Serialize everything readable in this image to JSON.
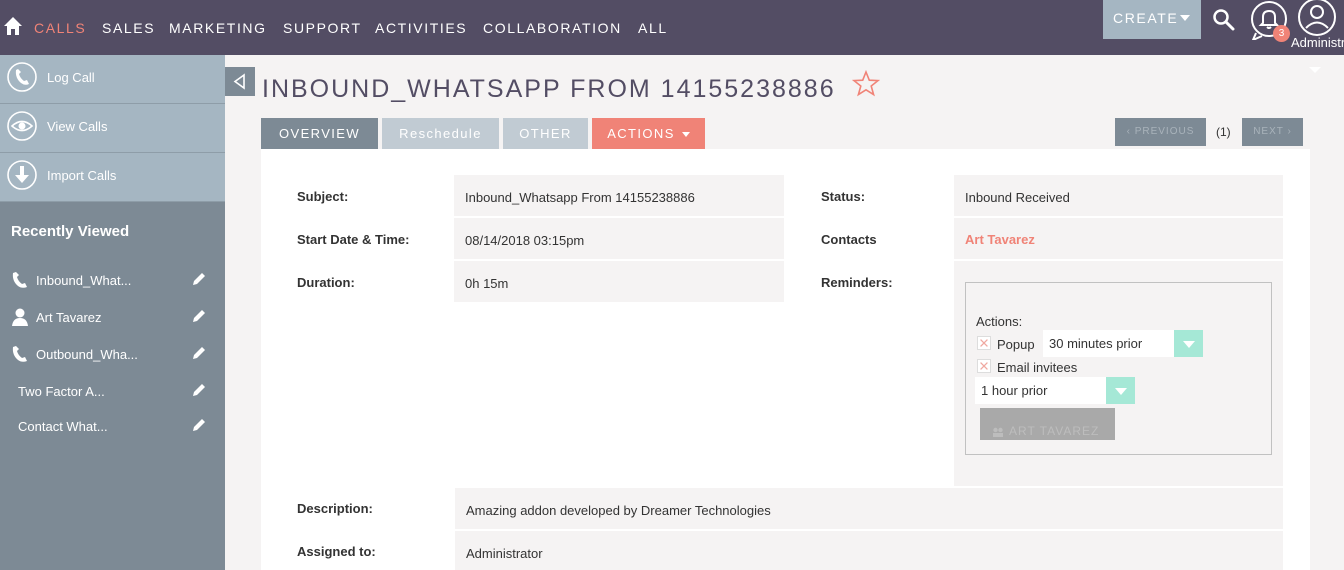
{
  "nav": {
    "items": [
      "CALLS",
      "SALES",
      "MARKETING",
      "SUPPORT",
      "ACTIVITIES",
      "COLLABORATION",
      "ALL"
    ],
    "create_label": "CREATE",
    "notification_count": "3",
    "user_label": "Administrator",
    "accent_color": "#f08377",
    "bar_color": "#534d64"
  },
  "sidebar": {
    "actions": [
      {
        "label": "Log Call",
        "icon": "phone-icon"
      },
      {
        "label": "View Calls",
        "icon": "eye-icon"
      },
      {
        "label": "Import Calls",
        "icon": "download-icon"
      }
    ],
    "recent_title": "Recently Viewed",
    "recent": [
      {
        "label": "Inbound_What...",
        "icon": "phone-icon"
      },
      {
        "label": "Art Tavarez",
        "icon": "person-icon"
      },
      {
        "label": "Outbound_Wha...",
        "icon": "phone-icon"
      },
      {
        "label": "Two Factor A...",
        "icon": ""
      },
      {
        "label": "Contact What...",
        "icon": ""
      }
    ]
  },
  "record": {
    "title": "INBOUND_WHATSAPP FROM 14155238886"
  },
  "tabs": {
    "overview": "OVERVIEW",
    "reschedule": "Reschedule",
    "other": "OTHER",
    "actions": "ACTIONS"
  },
  "pager": {
    "previous": "PREVIOUS",
    "count": "(1)",
    "next": "NEXT"
  },
  "fields": {
    "subject_label": "Subject:",
    "subject_value": "Inbound_Whatsapp From 14155238886",
    "start_label": "Start Date & Time:",
    "start_value": "08/14/2018 03:15pm",
    "duration_label": "Duration:",
    "duration_value": "0h 15m",
    "status_label": "Status:",
    "status_value": "Inbound Received",
    "contacts_label": "Contacts",
    "contacts_value": "Art Tavarez",
    "reminders_label": "Reminders:",
    "description_label": "Description:",
    "description_value": "Amazing addon developed by Dreamer Technologies",
    "assigned_label": "Assigned to:",
    "assigned_value": "Administrator"
  },
  "reminders": {
    "actions_label": "Actions:",
    "popup_label": "Popup",
    "popup_timing": "30 minutes prior",
    "email_label": "Email invitees",
    "email_timing": "1 hour prior",
    "invitee_button": "ART TAVAREZ"
  }
}
